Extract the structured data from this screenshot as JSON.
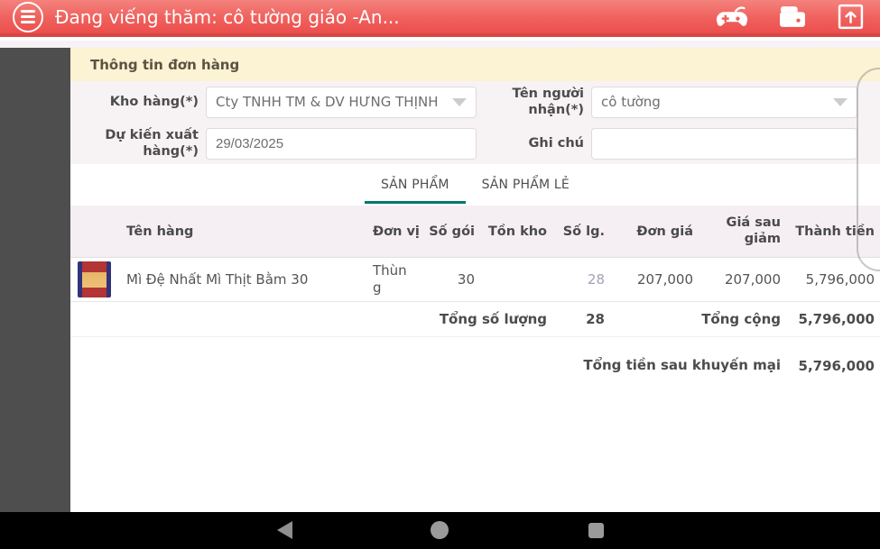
{
  "app_bar": {
    "title": "Đang viếng thăm: cô tường giáo -An...",
    "icons": {
      "menu": "menu-icon",
      "gamepad": "gamepad-icon",
      "wallet": "wallet-icon",
      "upload": "upload-icon"
    }
  },
  "section": {
    "title": "Thông tin đơn hàng"
  },
  "form": {
    "warehouse": {
      "label": "Kho hàng(*)",
      "value": "Cty TNHH TM & DV HƯNG THỊNH"
    },
    "receiver": {
      "label": "Tên người nhận(*)",
      "value": "cô tường"
    },
    "ship_date": {
      "label": "Dự kiến xuất hàng(*)",
      "value": "29/03/2025"
    },
    "note": {
      "label": "Ghi chú",
      "value": ""
    }
  },
  "tabs": [
    {
      "label": "SẢN PHẨM",
      "active": true
    },
    {
      "label": "SẢN PHẨM LẺ",
      "active": false
    }
  ],
  "table": {
    "columns": [
      "Tên hàng",
      "Đơn vị",
      "Số gói",
      "Tồn kho",
      "Số lg.",
      "Đơn giá",
      "Giá sau giảm",
      "Thành tiền"
    ],
    "rows": [
      {
        "name": "Mì Đệ Nhất Mì Thịt Bằm 30",
        "unit": "Thùng",
        "packages": "30",
        "stock": "",
        "qty": "28",
        "unit_price": "207,000",
        "price_after_discount": "207,000",
        "amount": "5,796,000"
      }
    ]
  },
  "totals": {
    "qty_label": "Tổng số lượng",
    "qty_value": "28",
    "grand_label": "Tổng cộng",
    "grand_value": "5,796,000",
    "after_promo_label": "Tổng tiền sau khuyến mại",
    "after_promo_value": "5,796,000"
  },
  "nav_bar": {
    "icons": {
      "back": "back-icon",
      "home": "home-icon",
      "recents": "recents-icon"
    }
  },
  "colors": {
    "appbar_red": "#ee5a56",
    "appbar_border": "#d64643",
    "cream_header": "#fcf2d4",
    "form_bg": "#f7f2f4",
    "table_header_bg": "#f5eff3",
    "accent_teal": "#00796b",
    "drawer_gray": "#4e4e4e",
    "light_qty": "#a2a2b5",
    "navbar_black": "#000000"
  }
}
